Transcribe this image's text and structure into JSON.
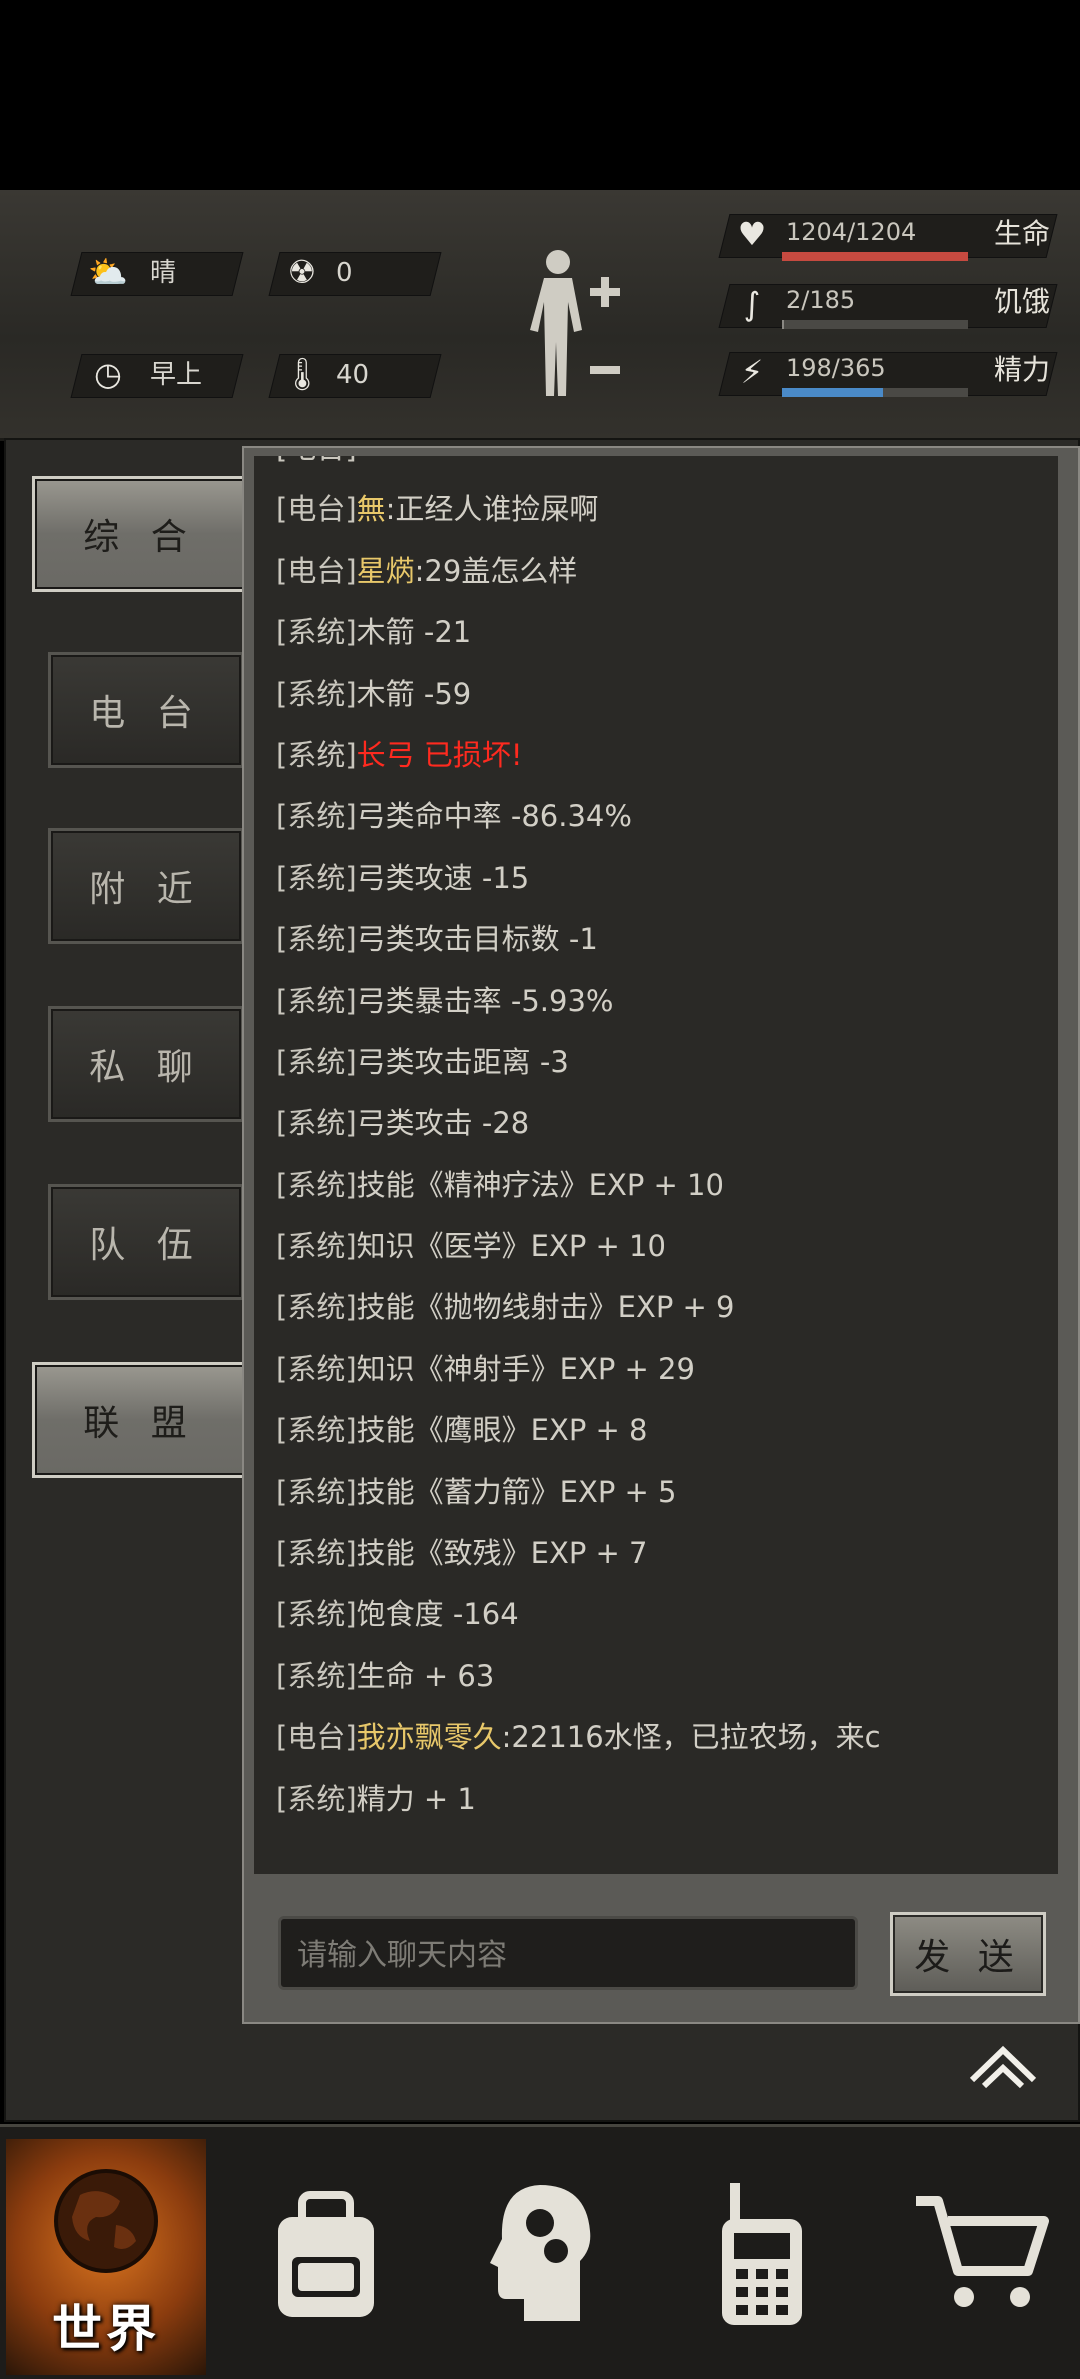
{
  "hud": {
    "weather": "晴",
    "radiation": "0",
    "time_of_day": "早上",
    "temperature": "40",
    "stats": [
      {
        "label": "生命",
        "value": "1204/1204",
        "fill": 1.0,
        "color": "#c64a40"
      },
      {
        "label": "饥饿",
        "value": "2/185",
        "fill": 0.011,
        "color": "#8a8883"
      },
      {
        "label": "精力",
        "value": "198/365",
        "fill": 0.542,
        "color": "#4a8ac8"
      }
    ]
  },
  "tabs": [
    "综 合",
    "电 台",
    "附 近",
    "私 聊",
    "队 伍",
    "联 盟"
  ],
  "active_tab": 0,
  "chat": {
    "messages": [
      {
        "tag": "[电台]",
        "name": "",
        "text": "",
        "style": "normal"
      },
      {
        "tag": "[电台]",
        "name": "無",
        "text": ":正经人谁捡屎啊",
        "style": "name"
      },
      {
        "tag": "[电台]",
        "name": "星焫",
        "text": ":29盖怎么样",
        "style": "name"
      },
      {
        "tag": "[系统]",
        "name": "",
        "text": "木箭 -21",
        "style": "normal"
      },
      {
        "tag": "[系统]",
        "name": "",
        "text": "木箭 -59",
        "style": "normal"
      },
      {
        "tag": "[系统]",
        "name": "",
        "text": "长弓 已损坏!",
        "style": "alert"
      },
      {
        "tag": "[系统]",
        "name": "",
        "text": "弓类命中率 -86.34%",
        "style": "normal"
      },
      {
        "tag": "[系统]",
        "name": "",
        "text": "弓类攻速 -15",
        "style": "normal"
      },
      {
        "tag": "[系统]",
        "name": "",
        "text": "弓类攻击目标数 -1",
        "style": "normal"
      },
      {
        "tag": "[系统]",
        "name": "",
        "text": "弓类暴击率 -5.93%",
        "style": "normal"
      },
      {
        "tag": "[系统]",
        "name": "",
        "text": "弓类攻击距离 -3",
        "style": "normal"
      },
      {
        "tag": "[系统]",
        "name": "",
        "text": "弓类攻击 -28",
        "style": "normal"
      },
      {
        "tag": "[系统]",
        "name": "",
        "text": "技能《精神疗法》EXP + 10",
        "style": "normal"
      },
      {
        "tag": "[系统]",
        "name": "",
        "text": "知识《医学》EXP + 10",
        "style": "normal"
      },
      {
        "tag": "[系统]",
        "name": "",
        "text": "技能《抛物线射击》EXP + 9",
        "style": "normal"
      },
      {
        "tag": "[系统]",
        "name": "",
        "text": "知识《神射手》EXP + 29",
        "style": "normal"
      },
      {
        "tag": "[系统]",
        "name": "",
        "text": "技能《鹰眼》EXP + 8",
        "style": "normal"
      },
      {
        "tag": "[系统]",
        "name": "",
        "text": "技能《蓄力箭》EXP + 5",
        "style": "normal"
      },
      {
        "tag": "[系统]",
        "name": "",
        "text": "技能《致残》EXP + 7",
        "style": "normal"
      },
      {
        "tag": "[系统]",
        "name": "",
        "text": "饱食度 -164",
        "style": "normal"
      },
      {
        "tag": "[系统]",
        "name": "",
        "text": "生命 + 63",
        "style": "normal"
      },
      {
        "tag": "[电台]",
        "name": "我亦飘零久",
        "text": ":22116水怪，已拉农场，来c",
        "style": "name"
      },
      {
        "tag": "[系统]",
        "name": "",
        "text": "精力 + 1",
        "style": "normal"
      }
    ],
    "input_placeholder": "请输入聊天内容",
    "send_label": "发 送"
  },
  "bottom_nav": {
    "world_label": "世界",
    "items": [
      "globe-icon",
      "backpack-icon",
      "skills-head-icon",
      "walkie-talkie-icon",
      "shopping-cart-icon"
    ]
  }
}
